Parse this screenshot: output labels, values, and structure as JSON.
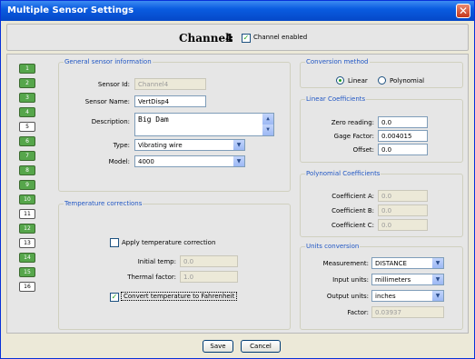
{
  "window": {
    "title": "Multiple Sensor Settings",
    "close": "✕"
  },
  "header": {
    "channel_label": "Channel:",
    "channel_value": "4",
    "channel_enabled": "Channel enabled"
  },
  "channels": [
    "1",
    "2",
    "3",
    "4",
    "5",
    "6",
    "7",
    "8",
    "9",
    "10",
    "11",
    "12",
    "13",
    "14",
    "15",
    "16"
  ],
  "general": {
    "legend": "General sensor information",
    "sensor_id_label": "Sensor Id:",
    "sensor_id": "Channel4",
    "sensor_name_label": "Sensor Name:",
    "sensor_name": "VertDisp4",
    "description_label": "Description:",
    "description": "Big Dam",
    "type_label": "Type:",
    "type": "Vibrating wire",
    "model_label": "Model:",
    "model": "4000"
  },
  "temperature": {
    "legend": "Temperature corrections",
    "apply": "Apply temperature correction",
    "initial_temp_label": "Initial temp:",
    "initial_temp": "0.0",
    "thermal_label": "Thermal factor:",
    "thermal": "1.0",
    "convert": "Convert temperature to Fahrenheit"
  },
  "conversion": {
    "legend": "Conversion method",
    "linear": "Linear",
    "polynomial": "Polynomial"
  },
  "linear": {
    "legend": "Linear Coefficients",
    "zero_label": "Zero reading:",
    "zero": "0.0",
    "gage_label": "Gage Factor:",
    "gage": "0.004015",
    "offset_label": "Offset:",
    "offset": "0.0"
  },
  "polynomial": {
    "legend": "Polynomial Coefficients",
    "a_label": "Coefficient A:",
    "a": "0.0",
    "b_label": "Coefficient B:",
    "b": "0.0",
    "c_label": "Coefficient C:",
    "c": "0.0"
  },
  "units": {
    "legend": "Units conversion",
    "measurement_label": "Measurement:",
    "measurement": "DISTANCE",
    "input_label": "Input units:",
    "input": "millimeters",
    "output_label": "Output units:",
    "output": "inches",
    "factor_label": "Factor:",
    "factor": "0.03937"
  },
  "buttons": {
    "save": "Save",
    "cancel": "Cancel"
  }
}
